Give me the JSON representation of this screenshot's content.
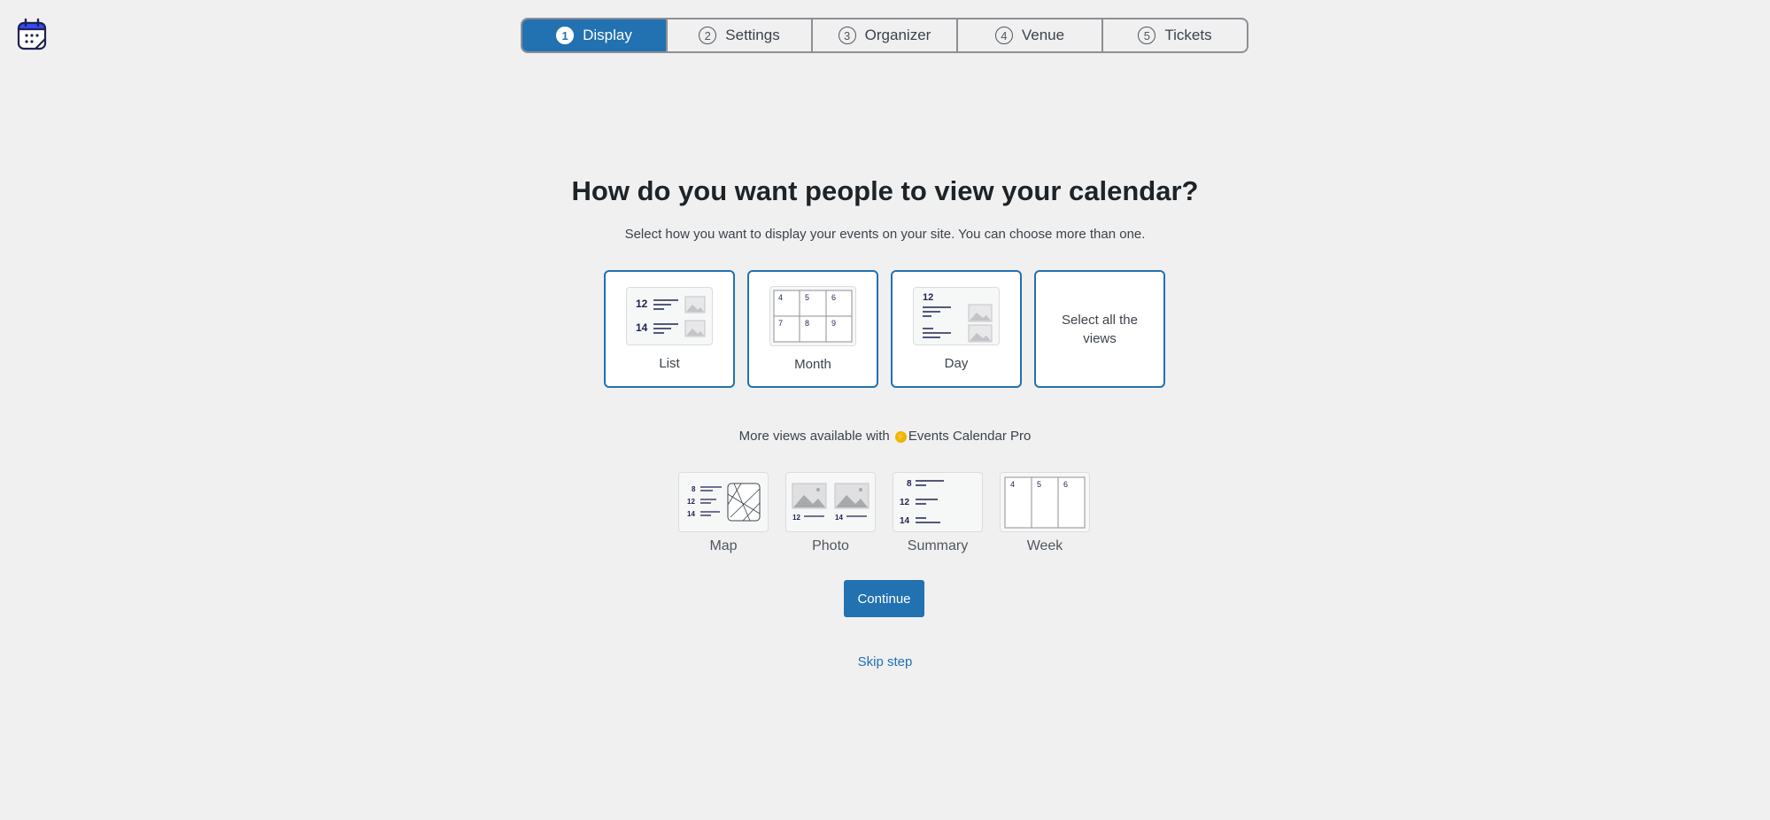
{
  "stepper": {
    "steps": [
      {
        "num": "1",
        "label": "Display",
        "active": true
      },
      {
        "num": "2",
        "label": "Settings"
      },
      {
        "num": "3",
        "label": "Organizer"
      },
      {
        "num": "4",
        "label": "Venue"
      },
      {
        "num": "5",
        "label": "Tickets"
      }
    ]
  },
  "main": {
    "title": "How do you want people to view your calendar?",
    "subtitle": "Select how you want to display your events on your site. You can choose more than one."
  },
  "views": [
    {
      "label": "List",
      "icon": "list-view-icon",
      "thumb_numbers": [
        "12",
        "14"
      ]
    },
    {
      "label": "Month",
      "icon": "month-view-icon",
      "thumb_numbers": [
        "4",
        "5",
        "6",
        "7",
        "8",
        "9"
      ]
    },
    {
      "label": "Day",
      "icon": "day-view-icon",
      "thumb_numbers": [
        "12"
      ]
    },
    {
      "label": "Select all the views"
    }
  ],
  "pro": {
    "text_before": "More views available with",
    "product": "Events Calendar Pro",
    "icon": "lightning-bolt-icon",
    "views": [
      {
        "label": "Map",
        "icon": "map-view-icon",
        "thumb_numbers": [
          "8",
          "12",
          "14"
        ]
      },
      {
        "label": "Photo",
        "icon": "photo-view-icon",
        "thumb_numbers": [
          "12",
          "14"
        ]
      },
      {
        "label": "Summary",
        "icon": "summary-view-icon",
        "thumb_numbers": [
          "8",
          "12",
          "14"
        ]
      },
      {
        "label": "Week",
        "icon": "week-view-icon",
        "thumb_numbers": [
          "4",
          "5",
          "6"
        ]
      }
    ]
  },
  "actions": {
    "continue_label": "Continue",
    "skip_label": "Skip step"
  },
  "colors": {
    "accent": "#2271b1",
    "background": "#f0f0f1"
  }
}
